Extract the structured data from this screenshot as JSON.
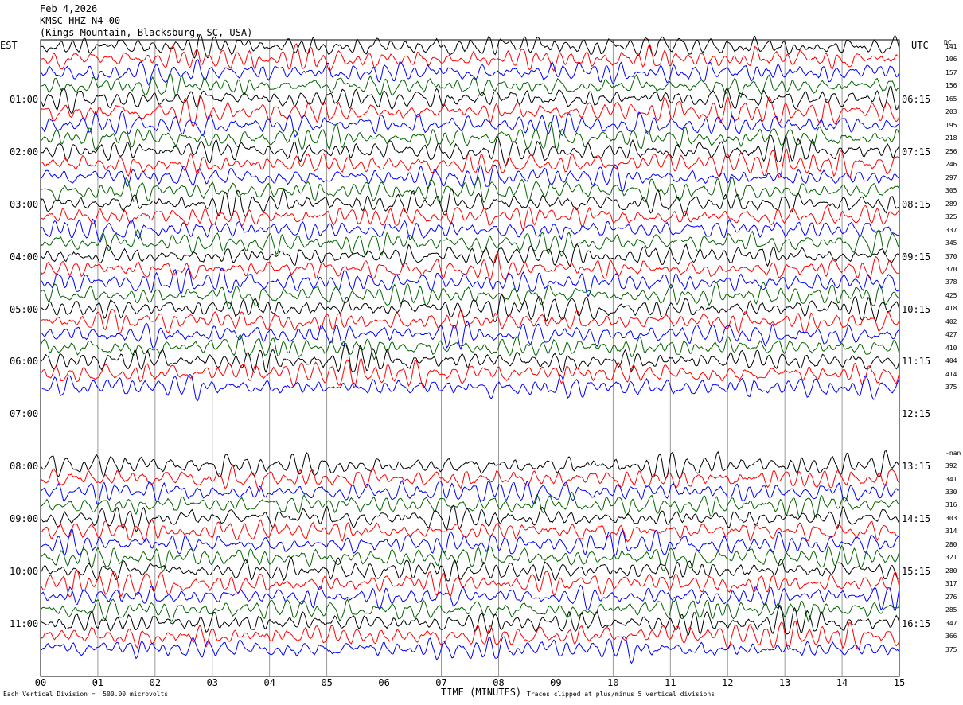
{
  "header": {
    "date": "Feb 4,2026",
    "station": "KMSC HHZ N4 00",
    "location": "(Kings Mountain, Blacksburg, SC, USA)"
  },
  "left_tz": "EST",
  "right_tz": "UTC",
  "dc_label": "DC",
  "footer": {
    "vertical_division": "Each Vertical Division =  500.00 microvolts",
    "clip_note": "Traces clipped at plus/minus 5 vertical divisions"
  },
  "chart_data": {
    "type": "line",
    "xlabel": "TIME (MINUTES)",
    "xlim": [
      0,
      15
    ],
    "x_ticks": [
      "00",
      "01",
      "02",
      "03",
      "04",
      "05",
      "06",
      "07",
      "08",
      "09",
      "10",
      "11",
      "12",
      "13",
      "14",
      "15"
    ],
    "left_times": [
      "01:00",
      "02:00",
      "03:00",
      "04:00",
      "05:00",
      "06:00",
      "07:00",
      "08:00",
      "09:00",
      "10:00",
      "11:00"
    ],
    "right_times": [
      "06:15",
      "07:15",
      "08:15",
      "09:15",
      "10:15",
      "11:15",
      "12:15",
      "13:15",
      "14:15",
      "15:15",
      "16:15"
    ],
    "trace_colors": [
      "#000000",
      "#ff0000",
      "#0000ff",
      "#006400"
    ],
    "dc_offsets_block1": [
      "141",
      "106",
      "157",
      "156",
      "165",
      "203",
      "195",
      "218",
      "256",
      "246",
      "297",
      "305",
      "289",
      "325",
      "337",
      "345",
      "370",
      "370",
      "378",
      "425",
      "418",
      "402",
      "427",
      "410",
      "404",
      "414",
      "375"
    ],
    "dc_offsets_block2": [
      "-nan",
      "392",
      "341",
      "330",
      "316",
      "303",
      "314",
      "280",
      "321",
      "280",
      "317",
      "276",
      "285",
      "347",
      "366",
      "375"
    ],
    "gap_rows": 4,
    "first_row_missing_block2": true
  }
}
